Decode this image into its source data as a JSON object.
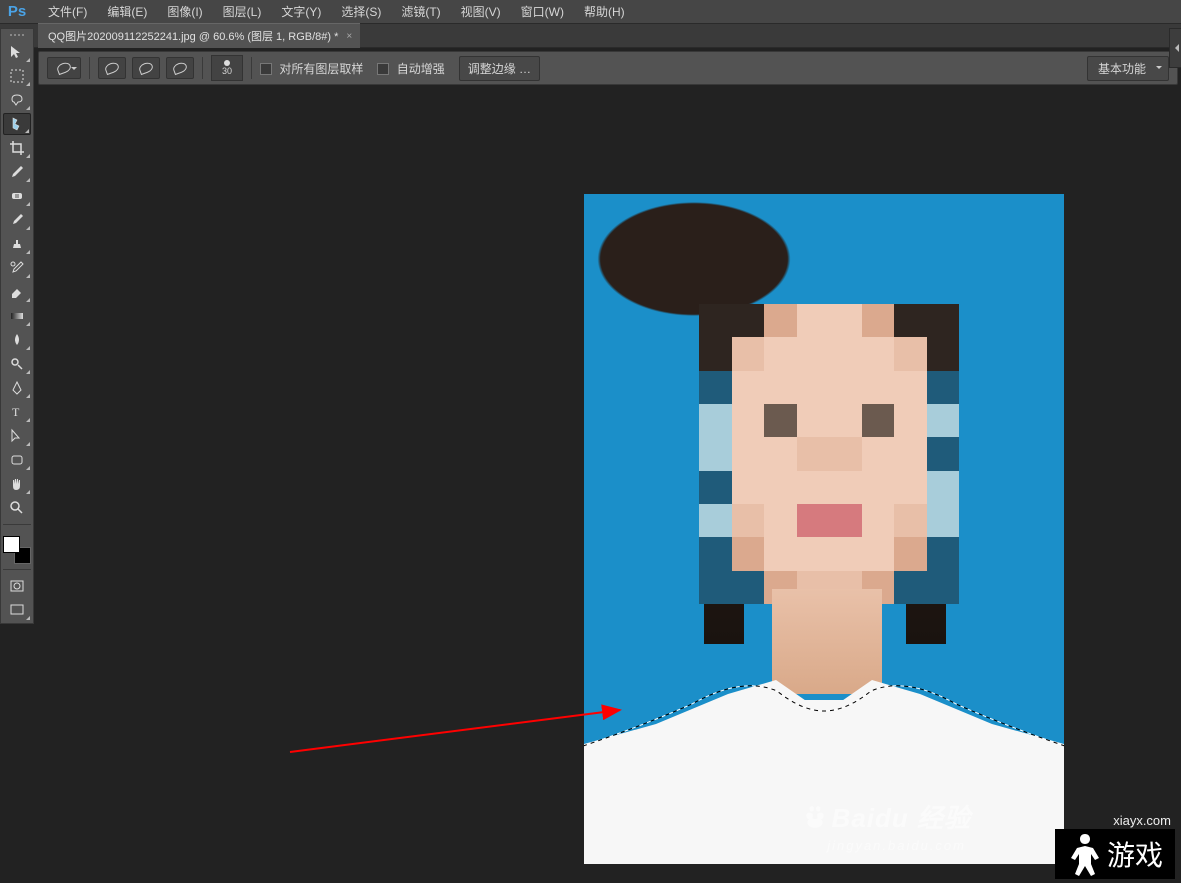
{
  "app": {
    "name": "Ps"
  },
  "menu": {
    "items": [
      "文件(F)",
      "编辑(E)",
      "图像(I)",
      "图层(L)",
      "文字(Y)",
      "选择(S)",
      "滤镜(T)",
      "视图(V)",
      "窗口(W)",
      "帮助(H)"
    ]
  },
  "tab": {
    "title": "QQ图片202009112252241.jpg @ 60.6% (图层 1, RGB/8#) *",
    "close": "×"
  },
  "options": {
    "brush_size": "30",
    "sample_all_label": "对所有图层取样",
    "auto_enhance_label": "自动增强",
    "refine_edge_label": "调整边缘 …",
    "workspace_label": "基本功能"
  },
  "tools": {
    "list": [
      "move-tool",
      "marquee-tool",
      "lasso-tool",
      "quick-selection-tool",
      "crop-tool",
      "eyedropper-tool",
      "healing-brush-tool",
      "brush-tool",
      "clone-stamp-tool",
      "history-brush-tool",
      "eraser-tool",
      "gradient-tool",
      "blur-tool",
      "dodge-tool",
      "pen-tool",
      "type-tool",
      "path-selection-tool",
      "shape-tool",
      "hand-tool",
      "zoom-tool"
    ],
    "selected_index": 3
  },
  "colors": {
    "foreground": "#ffffff",
    "background": "#000000"
  },
  "watermarks": {
    "baidu_main": "Baidu 经验",
    "baidu_sub": "jingyan.baidu.com",
    "xiayx": "xiayx.com",
    "game_logo": "游戏"
  }
}
